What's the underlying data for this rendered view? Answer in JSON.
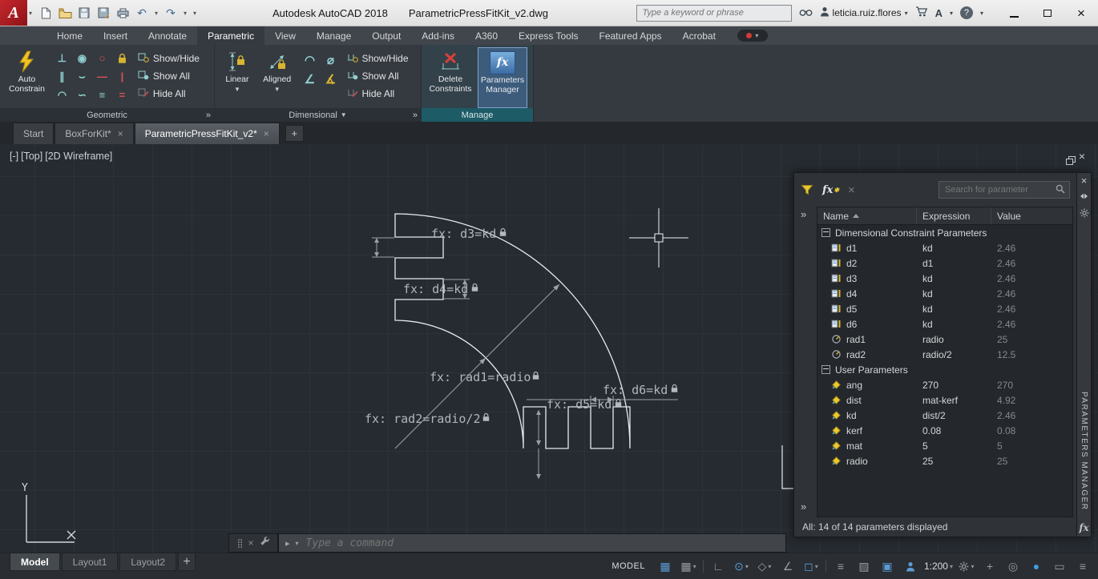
{
  "titlebar": {
    "app_title": "Autodesk AutoCAD 2018",
    "doc_title": "ParametricPressFitKit_v2.dwg",
    "search_placeholder": "Type a keyword or phrase",
    "username": "leticia.ruiz.flores"
  },
  "ribbon": {
    "tabs": [
      {
        "label": "Home"
      },
      {
        "label": "Insert"
      },
      {
        "label": "Annotate"
      },
      {
        "label": "Parametric",
        "active": true
      },
      {
        "label": "View"
      },
      {
        "label": "Manage"
      },
      {
        "label": "Output"
      },
      {
        "label": "Add-ins"
      },
      {
        "label": "A360"
      },
      {
        "label": "Express Tools"
      },
      {
        "label": "Featured Apps"
      },
      {
        "label": "Acrobat"
      }
    ],
    "panels": {
      "geometric": {
        "label": "Geometric",
        "auto_constrain_label": "Auto Constrain",
        "show_hide": "Show/Hide",
        "show_all": "Show All",
        "hide_all": "Hide All",
        "constraint_icons": [
          {
            "name": "perpendicular-constraint-icon",
            "glyph": "⊥",
            "color": "#8fd0d0"
          },
          {
            "name": "coincident-constraint-icon",
            "glyph": "◉",
            "color": "#8fd0d0"
          },
          {
            "name": "concentric-constraint-icon",
            "glyph": "○",
            "color": "#e05252"
          },
          {
            "name": "fix-constraint-icon",
            "glyph": "lock",
            "color": "#d8b431"
          },
          {
            "name": "parallel-constraint-icon",
            "glyph": "∥",
            "color": "#8fd0d0"
          },
          {
            "name": "tangent-constraint-icon",
            "glyph": "⌣",
            "color": "#8fd0d0"
          },
          {
            "name": "horizontal-constraint-icon",
            "glyph": "—",
            "color": "#e05252"
          },
          {
            "name": "vertical-constraint-icon",
            "glyph": "|",
            "color": "#e05252"
          },
          {
            "name": "smooth-constraint-icon",
            "glyph": "◠",
            "color": "#8fd0d0"
          },
          {
            "name": "symmetric-constraint-icon",
            "glyph": "∽",
            "color": "#8fd0d0"
          },
          {
            "name": "collinear-constraint-icon",
            "glyph": "≡",
            "color": "#8fd0d0"
          },
          {
            "name": "equal-constraint-icon",
            "glyph": "=",
            "color": "#e05252"
          }
        ]
      },
      "dimensional": {
        "label": "Dimensional",
        "linear_label": "Linear",
        "aligned_label": "Aligned",
        "show_hide": "Show/Hide",
        "show_all": "Show All",
        "hide_all": "Hide All",
        "small_icons": [
          {
            "name": "radius-constraint-icon",
            "glyph": "◠",
            "color": "#8fd0d0"
          },
          {
            "name": "diameter-constraint-icon",
            "glyph": "⌀",
            "color": "#8fd0d0"
          },
          {
            "name": "angular-constraint-icon",
            "glyph": "∠",
            "color": "#8fd0d0"
          },
          {
            "name": "convert-constraint-icon",
            "glyph": "∡",
            "color": "#d8b431"
          }
        ]
      },
      "manage": {
        "label": "Manage",
        "delete_constraints_label": "Delete Constraints",
        "parameters_manager_label": "Parameters Manager"
      }
    }
  },
  "file_tabs": [
    {
      "label": "Start",
      "active": false,
      "closable": false
    },
    {
      "label": "BoxForKit*",
      "active": false,
      "closable": true
    },
    {
      "label": "ParametricPressFitKit_v2*",
      "active": true,
      "closable": true
    }
  ],
  "viewport": {
    "controls": [
      "[-]",
      "[Top]",
      "[2D Wireframe]"
    ],
    "constraint_labels": [
      "fx: d3=kd",
      "fx: d4=kd",
      "fx: rad1=radio",
      "fx: rad2=radio/2",
      "fx: d6=kd",
      "fx: d5=kd"
    ],
    "ucs_y_label": "Y"
  },
  "parameters_manager": {
    "title": "PARAMETERS MANAGER",
    "search_placeholder": "Search for parameter",
    "columns": [
      "Name",
      "Expression",
      "Value"
    ],
    "groups": [
      {
        "label": "Dimensional Constraint Parameters",
        "rows": [
          {
            "name": "d1",
            "expression": "kd",
            "value": "2.46",
            "icon": "dim"
          },
          {
            "name": "d2",
            "expression": "d1",
            "value": "2.46",
            "icon": "dim"
          },
          {
            "name": "d3",
            "expression": "kd",
            "value": "2.46",
            "icon": "dim"
          },
          {
            "name": "d4",
            "expression": "kd",
            "value": "2.46",
            "icon": "dim"
          },
          {
            "name": "d5",
            "expression": "kd",
            "value": "2.46",
            "icon": "dim"
          },
          {
            "name": "d6",
            "expression": "kd",
            "value": "2.46",
            "icon": "dim"
          },
          {
            "name": "rad1",
            "expression": "radio",
            "value": "25",
            "icon": "rad"
          },
          {
            "name": "rad2",
            "expression": "radio/2",
            "value": "12.5",
            "icon": "rad"
          }
        ]
      },
      {
        "label": "User Parameters",
        "rows": [
          {
            "name": "ang",
            "expression": "270",
            "value": "270",
            "icon": "user"
          },
          {
            "name": "dist",
            "expression": "mat-kerf",
            "value": "4.92",
            "icon": "user"
          },
          {
            "name": "kd",
            "expression": "dist/2",
            "value": "2.46",
            "icon": "user"
          },
          {
            "name": "kerf",
            "expression": "0.08",
            "value": "0.08",
            "icon": "user"
          },
          {
            "name": "mat",
            "expression": "5",
            "value": "5",
            "icon": "user"
          },
          {
            "name": "radio",
            "expression": "25",
            "value": "25",
            "icon": "user"
          }
        ]
      }
    ],
    "status_text": "All: 14 of 14 parameters displayed"
  },
  "command_line": {
    "placeholder": "Type a command"
  },
  "layout_tabs": [
    {
      "label": "Model",
      "active": true
    },
    {
      "label": "Layout1",
      "active": false
    },
    {
      "label": "Layout2",
      "active": false
    }
  ],
  "status_bar": {
    "model_label": "MODEL",
    "items": [
      {
        "name": "grid-display",
        "glyph": "▦",
        "color": "#5b9cd6"
      },
      {
        "name": "snap-mode",
        "glyph": "▦",
        "color": "#989da2",
        "dropdown": true
      },
      {
        "name": "separator"
      },
      {
        "name": "ortho-mode",
        "glyph": "∟",
        "color": "#989da2"
      },
      {
        "name": "polar-tracking",
        "glyph": "⊙",
        "color": "#5b9cd6",
        "dropdown": true
      },
      {
        "name": "isometric-drafting",
        "glyph": "◇",
        "color": "#989da2",
        "dropdown": true
      },
      {
        "name": "object-snap-tracking",
        "glyph": "∠",
        "color": "#989da2"
      },
      {
        "name": "object-snap",
        "glyph": "◻",
        "color": "#5b9cd6",
        "dropdown": true
      },
      {
        "name": "separator"
      },
      {
        "name": "lineweight",
        "glyph": "≡",
        "color": "#989da2"
      },
      {
        "name": "transparency",
        "glyph": "▨",
        "color": "#989da2"
      },
      {
        "name": "selection-cycling",
        "glyph": "▣",
        "color": "#5b9cd6"
      },
      {
        "name": "annotation-monitor",
        "glyph": "person",
        "color": "#5b9cd6"
      },
      {
        "name": "annotation-scale",
        "label": "1:200",
        "dropdown": true
      },
      {
        "name": "workspace-switching",
        "glyph": "gear",
        "dropdown": true
      },
      {
        "name": "annotation-add-scales",
        "glyph": "+",
        "color": "#989da2"
      },
      {
        "name": "isolate-objects",
        "glyph": "◎",
        "color": "#989da2"
      },
      {
        "name": "graphics-performance",
        "glyph": "●",
        "color": "#3f9be0"
      },
      {
        "name": "clean-screen",
        "glyph": "▭",
        "color": "#989da2"
      },
      {
        "name": "customize",
        "glyph": "≡",
        "color": "#989da2"
      }
    ]
  }
}
